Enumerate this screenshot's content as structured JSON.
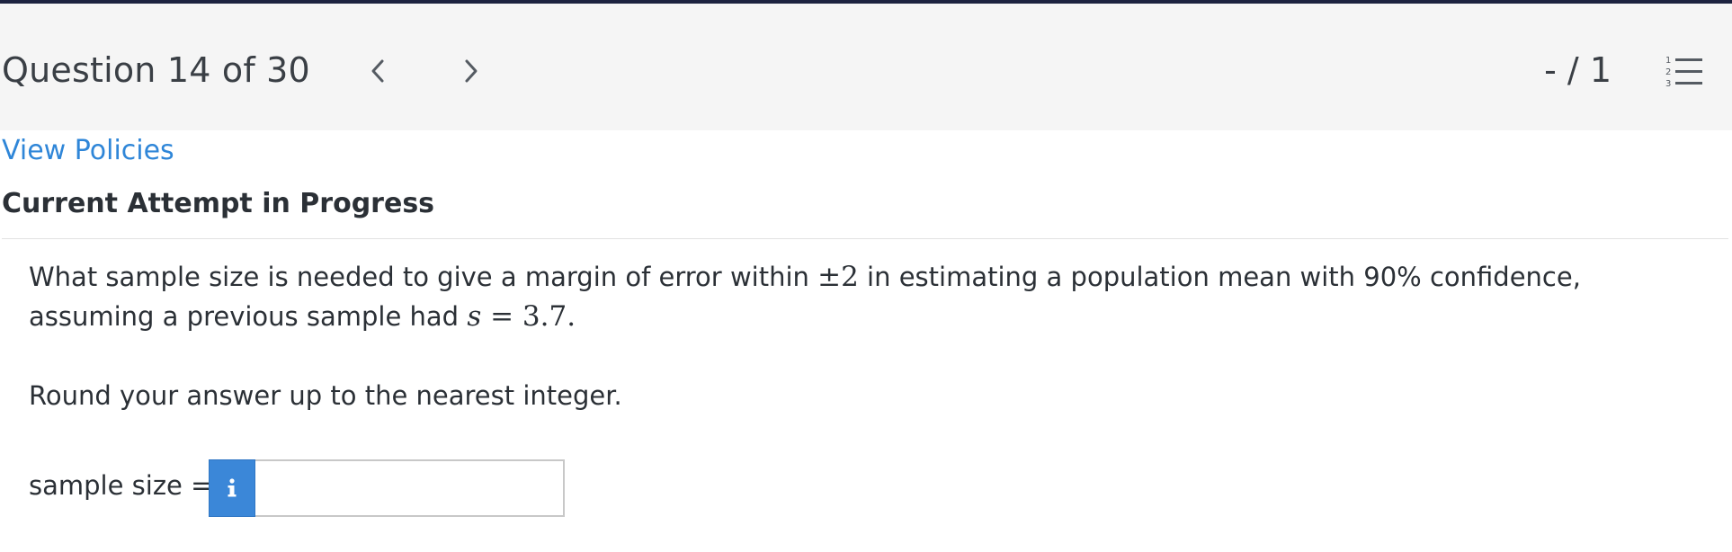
{
  "header": {
    "question_title": "Question 14 of 30",
    "score": "- / 1",
    "list_icon_numbers": [
      "1",
      "2",
      "3"
    ]
  },
  "links": {
    "view_policies": "View Policies"
  },
  "status": {
    "attempt": "Current Attempt in Progress"
  },
  "question": {
    "text_part1": "What sample size is needed to give a margin of error within ",
    "pm_symbol": "±",
    "margin_value": "2",
    "text_part2": " in estimating a population mean with 90% confidence, assuming a previous sample had ",
    "s_var": "s",
    "equals": " = ",
    "s_value": "3.7.",
    "instruction": "Round your answer up to the nearest integer."
  },
  "answer": {
    "label": "sample size =",
    "info_glyph": "i",
    "value": ""
  },
  "colors": {
    "link": "#2f86d8",
    "info_button": "#3b87d8",
    "header_bg": "#f5f5f5",
    "top_rule": "#1d2340"
  },
  "icons": [
    "chevron-left-icon",
    "chevron-right-icon",
    "numbered-list-icon",
    "info-icon"
  ]
}
